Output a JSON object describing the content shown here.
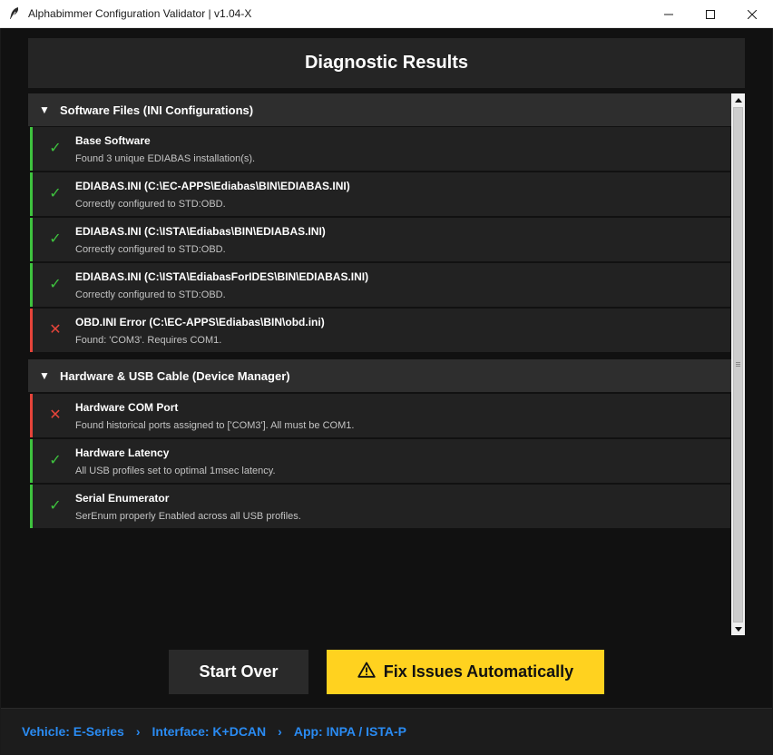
{
  "window": {
    "title": "Alphabimmer Configuration Validator | v1.04-X"
  },
  "header": {
    "title": "Diagnostic Results"
  },
  "sections": [
    {
      "caret": "▼",
      "title": "Software Files (INI Configurations)",
      "items": [
        {
          "status": "pass",
          "icon": "✓",
          "title": "Base Software",
          "detail": "Found 3 unique EDIABAS installation(s)."
        },
        {
          "status": "pass",
          "icon": "✓",
          "title": "EDIABAS.INI (C:\\EC-APPS\\Ediabas\\BIN\\EDIABAS.INI)",
          "detail": "Correctly configured to STD:OBD."
        },
        {
          "status": "pass",
          "icon": "✓",
          "title": "EDIABAS.INI (C:\\ISTA\\Ediabas\\BIN\\EDIABAS.INI)",
          "detail": "Correctly configured to STD:OBD."
        },
        {
          "status": "pass",
          "icon": "✓",
          "title": "EDIABAS.INI (C:\\ISTA\\EdiabasForIDES\\BIN\\EDIABAS.INI)",
          "detail": "Correctly configured to STD:OBD."
        },
        {
          "status": "fail",
          "icon": "✕",
          "title": "OBD.INI Error (C:\\EC-APPS\\Ediabas\\BIN\\obd.ini)",
          "detail": "Found: 'COM3'. Requires COM1."
        }
      ]
    },
    {
      "caret": "▼",
      "title": "Hardware & USB Cable (Device Manager)",
      "items": [
        {
          "status": "fail",
          "icon": "✕",
          "title": "Hardware COM Port",
          "detail": "Found historical ports assigned to ['COM3']. All must be COM1."
        },
        {
          "status": "pass",
          "icon": "✓",
          "title": "Hardware Latency",
          "detail": "All USB profiles set to optimal 1msec latency."
        },
        {
          "status": "pass",
          "icon": "✓",
          "title": "Serial Enumerator",
          "detail": "SerEnum properly Enabled across all USB profiles."
        }
      ]
    }
  ],
  "buttons": {
    "start_over": "Start Over",
    "fix_issues": "Fix Issues Automatically",
    "fix_icon": "⚠"
  },
  "footer": {
    "breadcrumbs": [
      "Vehicle: E-Series",
      "Interface: K+DCAN",
      "App: INPA / ISTA-P"
    ],
    "separator": "›"
  },
  "colors": {
    "pass": "#3ec23e",
    "fail": "#e5443a",
    "accent_yellow": "#ffd21f",
    "link_blue": "#2a8bf2"
  }
}
